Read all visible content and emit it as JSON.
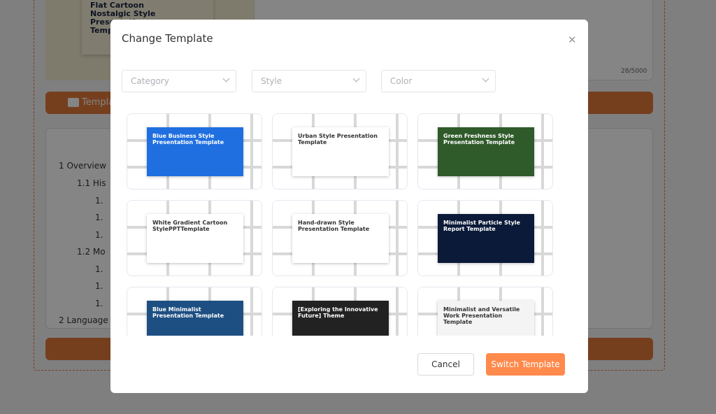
{
  "background": {
    "thumbnail_title": "Flat Cartoon Nostalgic Style Presentation Template",
    "char_counter": "28/5000",
    "template_button": "Template",
    "outline": [
      "1 Overview",
      "1.1 His",
      "1.",
      "1.",
      "1.",
      "1.2 Mo",
      "1.",
      "1.",
      "1.",
      "2 Language"
    ]
  },
  "modal": {
    "title": "Change Template",
    "close_icon": "close-icon",
    "filters": {
      "category": "Category",
      "style": "Style",
      "color": "Color"
    },
    "templates": [
      {
        "title": "Blue Business Style Presentation Template",
        "color": "#1f6fe0"
      },
      {
        "title": "Urban Style Presentation Template",
        "color": "#ffffff"
      },
      {
        "title": "Green Freshness Style Presentation Template",
        "color": "#2f5a2a"
      },
      {
        "title": "White Gradient Cartoon StylePPTTemplate",
        "color": "#ffffff"
      },
      {
        "title": "Hand-drawn Style Presentation Template",
        "color": "#ffffff"
      },
      {
        "title": "Minimalist Particle Style Report Template",
        "color": "#0a1a38"
      },
      {
        "title": "Blue Minimalist Presentation Template",
        "color": "#1e4f82"
      },
      {
        "title": "[Exploring the Innovative Future] Theme",
        "color": "#222222"
      },
      {
        "title": "Minimalist and Versatile Work Presentation Template",
        "color": "#f4f4f4"
      }
    ],
    "cancel_label": "Cancel",
    "switch_label": "Switch Template",
    "accent": "#ff8a4c"
  }
}
